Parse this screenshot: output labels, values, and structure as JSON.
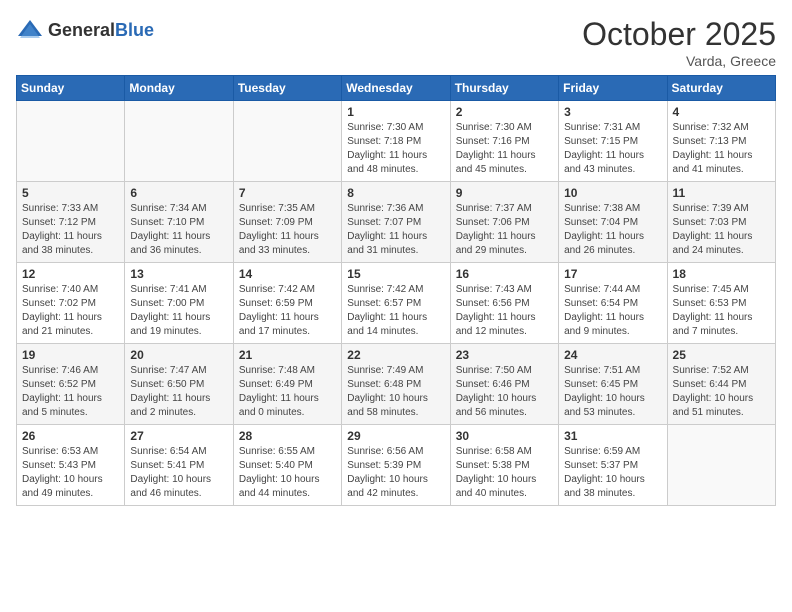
{
  "header": {
    "logo_general": "General",
    "logo_blue": "Blue",
    "month": "October 2025",
    "location": "Varda, Greece"
  },
  "weekdays": [
    "Sunday",
    "Monday",
    "Tuesday",
    "Wednesday",
    "Thursday",
    "Friday",
    "Saturday"
  ],
  "weeks": [
    [
      {
        "day": "",
        "info": ""
      },
      {
        "day": "",
        "info": ""
      },
      {
        "day": "",
        "info": ""
      },
      {
        "day": "1",
        "info": "Sunrise: 7:30 AM\nSunset: 7:18 PM\nDaylight: 11 hours\nand 48 minutes."
      },
      {
        "day": "2",
        "info": "Sunrise: 7:30 AM\nSunset: 7:16 PM\nDaylight: 11 hours\nand 45 minutes."
      },
      {
        "day": "3",
        "info": "Sunrise: 7:31 AM\nSunset: 7:15 PM\nDaylight: 11 hours\nand 43 minutes."
      },
      {
        "day": "4",
        "info": "Sunrise: 7:32 AM\nSunset: 7:13 PM\nDaylight: 11 hours\nand 41 minutes."
      }
    ],
    [
      {
        "day": "5",
        "info": "Sunrise: 7:33 AM\nSunset: 7:12 PM\nDaylight: 11 hours\nand 38 minutes."
      },
      {
        "day": "6",
        "info": "Sunrise: 7:34 AM\nSunset: 7:10 PM\nDaylight: 11 hours\nand 36 minutes."
      },
      {
        "day": "7",
        "info": "Sunrise: 7:35 AM\nSunset: 7:09 PM\nDaylight: 11 hours\nand 33 minutes."
      },
      {
        "day": "8",
        "info": "Sunrise: 7:36 AM\nSunset: 7:07 PM\nDaylight: 11 hours\nand 31 minutes."
      },
      {
        "day": "9",
        "info": "Sunrise: 7:37 AM\nSunset: 7:06 PM\nDaylight: 11 hours\nand 29 minutes."
      },
      {
        "day": "10",
        "info": "Sunrise: 7:38 AM\nSunset: 7:04 PM\nDaylight: 11 hours\nand 26 minutes."
      },
      {
        "day": "11",
        "info": "Sunrise: 7:39 AM\nSunset: 7:03 PM\nDaylight: 11 hours\nand 24 minutes."
      }
    ],
    [
      {
        "day": "12",
        "info": "Sunrise: 7:40 AM\nSunset: 7:02 PM\nDaylight: 11 hours\nand 21 minutes."
      },
      {
        "day": "13",
        "info": "Sunrise: 7:41 AM\nSunset: 7:00 PM\nDaylight: 11 hours\nand 19 minutes."
      },
      {
        "day": "14",
        "info": "Sunrise: 7:42 AM\nSunset: 6:59 PM\nDaylight: 11 hours\nand 17 minutes."
      },
      {
        "day": "15",
        "info": "Sunrise: 7:42 AM\nSunset: 6:57 PM\nDaylight: 11 hours\nand 14 minutes."
      },
      {
        "day": "16",
        "info": "Sunrise: 7:43 AM\nSunset: 6:56 PM\nDaylight: 11 hours\nand 12 minutes."
      },
      {
        "day": "17",
        "info": "Sunrise: 7:44 AM\nSunset: 6:54 PM\nDaylight: 11 hours\nand 9 minutes."
      },
      {
        "day": "18",
        "info": "Sunrise: 7:45 AM\nSunset: 6:53 PM\nDaylight: 11 hours\nand 7 minutes."
      }
    ],
    [
      {
        "day": "19",
        "info": "Sunrise: 7:46 AM\nSunset: 6:52 PM\nDaylight: 11 hours\nand 5 minutes."
      },
      {
        "day": "20",
        "info": "Sunrise: 7:47 AM\nSunset: 6:50 PM\nDaylight: 11 hours\nand 2 minutes."
      },
      {
        "day": "21",
        "info": "Sunrise: 7:48 AM\nSunset: 6:49 PM\nDaylight: 11 hours\nand 0 minutes."
      },
      {
        "day": "22",
        "info": "Sunrise: 7:49 AM\nSunset: 6:48 PM\nDaylight: 10 hours\nand 58 minutes."
      },
      {
        "day": "23",
        "info": "Sunrise: 7:50 AM\nSunset: 6:46 PM\nDaylight: 10 hours\nand 56 minutes."
      },
      {
        "day": "24",
        "info": "Sunrise: 7:51 AM\nSunset: 6:45 PM\nDaylight: 10 hours\nand 53 minutes."
      },
      {
        "day": "25",
        "info": "Sunrise: 7:52 AM\nSunset: 6:44 PM\nDaylight: 10 hours\nand 51 minutes."
      }
    ],
    [
      {
        "day": "26",
        "info": "Sunrise: 6:53 AM\nSunset: 5:43 PM\nDaylight: 10 hours\nand 49 minutes."
      },
      {
        "day": "27",
        "info": "Sunrise: 6:54 AM\nSunset: 5:41 PM\nDaylight: 10 hours\nand 46 minutes."
      },
      {
        "day": "28",
        "info": "Sunrise: 6:55 AM\nSunset: 5:40 PM\nDaylight: 10 hours\nand 44 minutes."
      },
      {
        "day": "29",
        "info": "Sunrise: 6:56 AM\nSunset: 5:39 PM\nDaylight: 10 hours\nand 42 minutes."
      },
      {
        "day": "30",
        "info": "Sunrise: 6:58 AM\nSunset: 5:38 PM\nDaylight: 10 hours\nand 40 minutes."
      },
      {
        "day": "31",
        "info": "Sunrise: 6:59 AM\nSunset: 5:37 PM\nDaylight: 10 hours\nand 38 minutes."
      },
      {
        "day": "",
        "info": ""
      }
    ]
  ]
}
